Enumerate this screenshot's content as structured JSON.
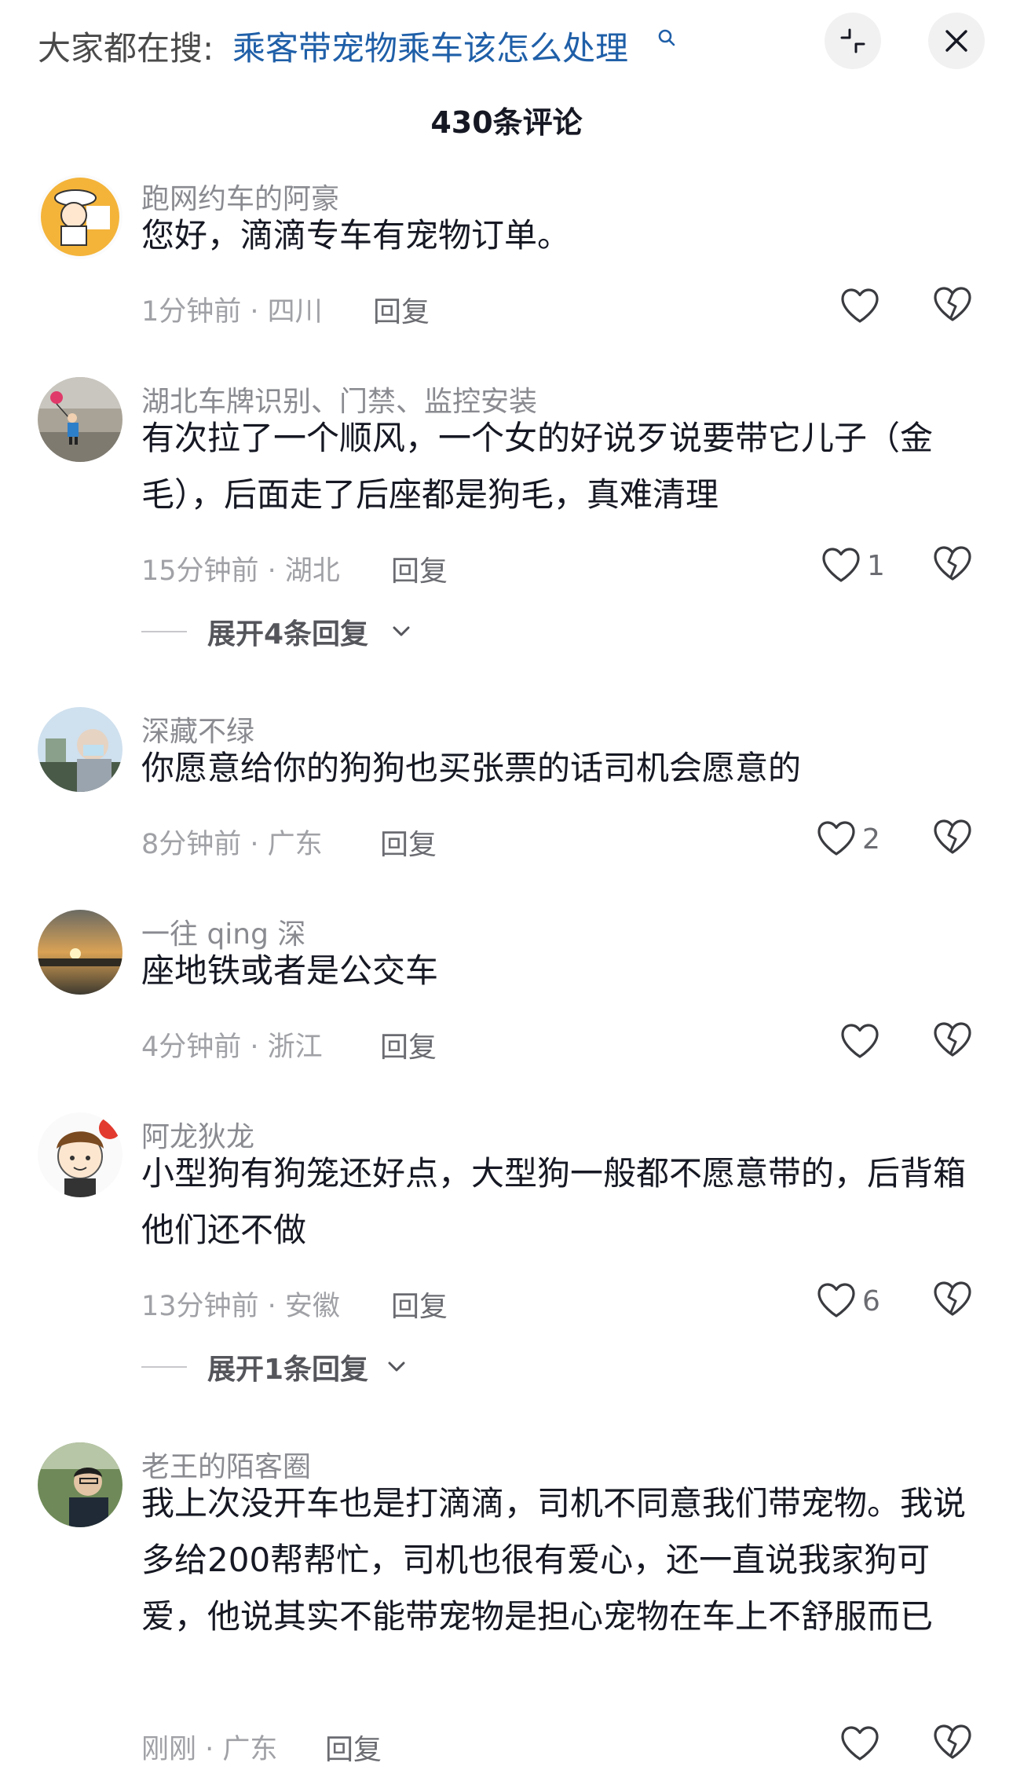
{
  "header": {
    "search_prefix": "大家都在搜:",
    "search_query": "乘客带宠物乘车该怎么处理",
    "comment_count": "430条评论"
  },
  "comments": [
    {
      "username": "跑网约车的阿豪",
      "text": "您好，滴滴专车有宠物订单。",
      "time_location": "1分钟前 · 四川",
      "reply": "回复",
      "likes": ""
    },
    {
      "username": "湖北车牌识别、门禁、监控安装",
      "text": "有次拉了一个顺风，一个女的好说歹说要带它儿子（金毛），后面走了后座都是狗毛，真难清理",
      "time_location": "15分钟前 · 湖北",
      "reply": "回复",
      "likes": "1",
      "expand_label": "展开4条回复"
    },
    {
      "username": "深藏不绿",
      "text": "你愿意给你的狗狗也买张票的话司机会愿意的",
      "time_location": "8分钟前 · 广东",
      "reply": "回复",
      "likes": "2"
    },
    {
      "username": "一往 qing 深",
      "text": "座地铁或者是公交车",
      "time_location": "4分钟前 · 浙江",
      "reply": "回复",
      "likes": ""
    },
    {
      "username": "阿龙狄龙",
      "text": "小型狗有狗笼还好点，大型狗一般都不愿意带的，后背箱他们还不做",
      "time_location": "13分钟前 · 安徽",
      "reply": "回复",
      "likes": "6",
      "expand_label": "展开1条回复"
    },
    {
      "username": "老王的陌客圈",
      "text": "我上次没开车也是打滴滴，司机不同意我们带宠物。我说多给200帮帮忙，司机也很有爱心，还一直说我家狗可爱，他说其实不能带宠物是担心宠物在车上不舒服而已",
      "time_location": "刚刚 · 广东",
      "reply": "回复",
      "likes": ""
    }
  ],
  "icons": {
    "like": "heart-outline-icon",
    "dislike": "broken-heart-icon",
    "shrink": "shrink-icon",
    "close": "close-icon",
    "search": "search-icon",
    "expand": "chevron-down-icon"
  },
  "colors": {
    "link": "#1f5fa8",
    "text": "#161823",
    "muted": "#a0a1a6"
  }
}
